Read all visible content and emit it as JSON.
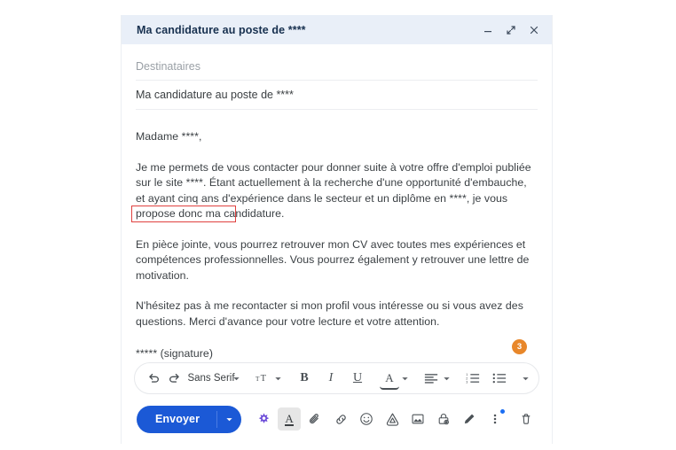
{
  "window": {
    "title": "Ma candidature au poste de ****",
    "controls": [
      {
        "name": "minimize-button",
        "label": "Réduire"
      },
      {
        "name": "expand-button",
        "label": "Agrandir"
      },
      {
        "name": "close-button",
        "label": "Fermer"
      }
    ]
  },
  "fields": {
    "recipients_placeholder": "Destinataires",
    "subject_value": "Ma candidature au poste de ****"
  },
  "body": {
    "paragraphs": [
      "Madame ****,",
      "Je me permets de vous contacter pour donner suite à votre offre d'emploi publiée sur le site ****. Étant actuellement à la recherche d'une opportunité d'embauche, et ayant cinq ans d'expérience dans le secteur et un diplôme en ****, je vous propose donc ma candidature.",
      "En pièce jointe, vous pourrez retrouver mon CV avec toutes mes expériences et compétences professionnelles. Vous pourrez également y retrouver une lettre de motivation.",
      "N'hésitez pas à me recontacter si mon profil vous intéresse ou si vous avez des questions. Merci d'avance pour votre lecture et votre attention.",
      "***** (signature)"
    ],
    "badge_count": "3",
    "badge_color": "#e8872a",
    "annotation_color": "#e0413f"
  },
  "format_toolbar": {
    "font_label": "Sans Serif",
    "buttons": [
      {
        "name": "undo-icon",
        "label": "Annuler"
      },
      {
        "name": "redo-icon",
        "label": "Rétablir"
      },
      {
        "name": "font-family-select",
        "label": "Sans Serif"
      },
      {
        "name": "font-size-icon",
        "label": "Taille de police"
      },
      {
        "name": "bold-button",
        "label": "B"
      },
      {
        "name": "italic-button",
        "label": "I"
      },
      {
        "name": "underline-button",
        "label": "U"
      },
      {
        "name": "text-color-button",
        "label": "A"
      },
      {
        "name": "align-button",
        "label": "Aligner"
      },
      {
        "name": "numbered-list-button",
        "label": "Liste numérotée"
      },
      {
        "name": "bulleted-list-button",
        "label": "Liste à puces"
      },
      {
        "name": "more-format-button",
        "label": "Plus d'options de mise en forme"
      }
    ]
  },
  "action_bar": {
    "send_label": "Envoyer",
    "send_color": "#1b59d6",
    "send_options_label": "Options d'envoi",
    "icons": [
      {
        "name": "gemini-icon",
        "label": "Aide-moi à écrire"
      },
      {
        "name": "format-text-icon",
        "label": "Options de mise en forme"
      },
      {
        "name": "attach-file-icon",
        "label": "Joindre des fichiers"
      },
      {
        "name": "insert-link-icon",
        "label": "Insérer un lien"
      },
      {
        "name": "emoji-icon",
        "label": "Insérer un emoji"
      },
      {
        "name": "drive-icon",
        "label": "Insérer des fichiers avec Drive"
      },
      {
        "name": "insert-photo-icon",
        "label": "Insérer une photo"
      },
      {
        "name": "confidential-mode-icon",
        "label": "Activer le mode confidentiel"
      },
      {
        "name": "signature-icon",
        "label": "Insérer une signature"
      },
      {
        "name": "more-options-icon",
        "label": "Plus d'options"
      }
    ],
    "discard_label": "Supprimer le brouillon"
  }
}
